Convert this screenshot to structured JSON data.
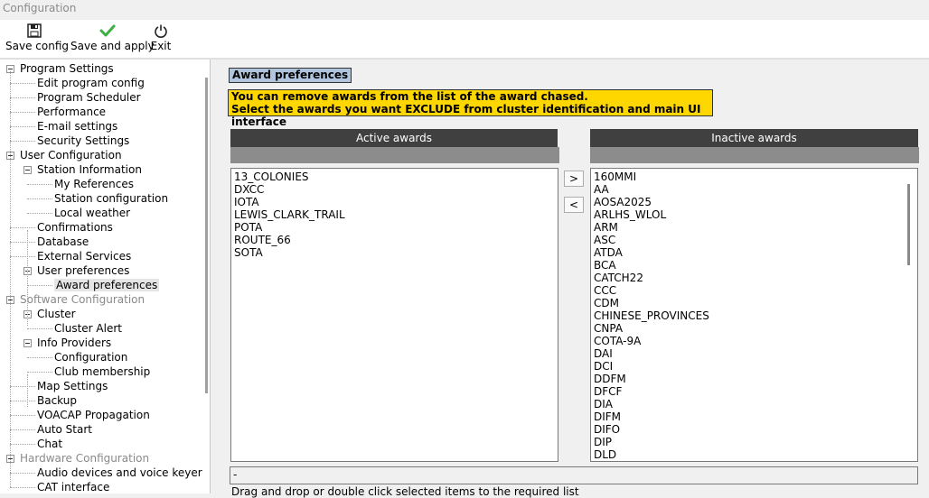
{
  "window": {
    "title": "Configuration"
  },
  "toolbar": {
    "save_config": "Save config",
    "save_apply": "Save and apply",
    "exit": "Exit"
  },
  "tree": [
    {
      "label": "Program Settings",
      "level": 0,
      "expander": true,
      "disabled": false
    },
    {
      "label": "Edit program config",
      "level": 1
    },
    {
      "label": "Program Scheduler",
      "level": 1
    },
    {
      "label": "Performance",
      "level": 1
    },
    {
      "label": "E-mail settings",
      "level": 1
    },
    {
      "label": "Security Settings",
      "level": 1
    },
    {
      "label": "User Configuration",
      "level": 0,
      "expander": true
    },
    {
      "label": "Station Information",
      "level": 1,
      "expander": true
    },
    {
      "label": "My References",
      "level": 2
    },
    {
      "label": "Station configuration",
      "level": 2
    },
    {
      "label": "Local weather",
      "level": 2
    },
    {
      "label": "Confirmations",
      "level": 1
    },
    {
      "label": "Database",
      "level": 1
    },
    {
      "label": "External Services",
      "level": 1
    },
    {
      "label": "User preferences",
      "level": 1,
      "expander": true
    },
    {
      "label": "Award preferences",
      "level": 2,
      "selected": true
    },
    {
      "label": "Software Configuration",
      "level": 0,
      "expander": true,
      "disabled": true
    },
    {
      "label": "Cluster",
      "level": 1,
      "expander": true
    },
    {
      "label": "Cluster Alert",
      "level": 2
    },
    {
      "label": "Info Providers",
      "level": 1,
      "expander": true
    },
    {
      "label": "Configuration",
      "level": 2
    },
    {
      "label": "Club membership",
      "level": 2
    },
    {
      "label": "Map Settings",
      "level": 1
    },
    {
      "label": "Backup",
      "level": 1
    },
    {
      "label": "VOACAP Propagation",
      "level": 1
    },
    {
      "label": "Auto Start",
      "level": 1
    },
    {
      "label": "Chat",
      "level": 1
    },
    {
      "label": "Hardware Configuration",
      "level": 0,
      "expander": true,
      "disabled": true
    },
    {
      "label": "Audio devices and voice keyer",
      "level": 1
    },
    {
      "label": "CAT interface",
      "level": 1
    }
  ],
  "panel": {
    "heading": "Award preferences",
    "notice_line1": "You can remove awards from the list of the award chased.",
    "notice_line2": "Select the awards you want EXCLUDE from cluster identification and main UI interface",
    "active_header": "Active awards",
    "inactive_header": "Inactive awards",
    "move_right": ">",
    "move_left": "<",
    "active_awards": [
      "13_COLONIES",
      "DXCC",
      "IOTA",
      "LEWIS_CLARK_TRAIL",
      "POTA",
      "ROUTE_66",
      "SOTA"
    ],
    "inactive_awards": [
      "160MMI",
      "AA",
      "AOSA2025",
      "ARLHS_WLOL",
      "ARM",
      "ASC",
      "ATDA",
      "BCA",
      "CATCH22",
      "CCC",
      "CDM",
      "CHINESE_PROVINCES",
      "CNPA",
      "COTA-9A",
      "DAI",
      "DCI",
      "DDFM",
      "DFCF",
      "DIA",
      "DIFM",
      "DIFO",
      "DIP",
      "DLD"
    ],
    "status": "-",
    "hint": "Drag and drop or double click selected items to the required list"
  },
  "colors": {
    "heading_bg": "#b0c4de",
    "notice_bg": "#ffd700",
    "column_header_bg": "#404040"
  }
}
